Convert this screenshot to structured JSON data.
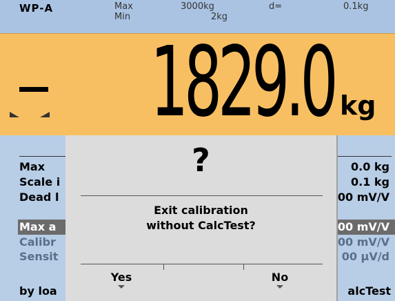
{
  "header": {
    "scale_id": "WP-A",
    "max_label": "Max",
    "min_label": "Min",
    "max_value": "3000kg",
    "min_value": "2kg",
    "d_label": "d=",
    "d_value": "0.1kg"
  },
  "weight": {
    "sign": "-",
    "value": "1829.0",
    "unit": "kg"
  },
  "menu": {
    "rows": [
      {
        "label": "Max",
        "value": "0.0 kg",
        "state": "normal"
      },
      {
        "label": "Scale i",
        "value": "0.1 kg",
        "state": "normal"
      },
      {
        "label": "Dead l",
        "value": "00 mV/V",
        "state": "normal"
      },
      {
        "label": "Max a",
        "value": "00 mV/V",
        "state": "selected"
      },
      {
        "label": "Calibr",
        "value": "00 mV/V",
        "state": "disabled"
      },
      {
        "label": "Sensit",
        "value": "00 µV/d",
        "state": "disabled"
      }
    ],
    "bottom_left": "by loa",
    "bottom_right": "alcTest"
  },
  "dialog": {
    "symbol": "?",
    "message_line1": "Exit calibration",
    "message_line2": "without CalcTest?",
    "yes_label": "Yes",
    "no_label": "No"
  },
  "colors": {
    "weight_background": "#f8bf62",
    "header_background": "#aac3e3",
    "menu_background": "#b8cde6",
    "dialog_background": "#dcdcdc",
    "selected_row": "#6b6b6b"
  }
}
